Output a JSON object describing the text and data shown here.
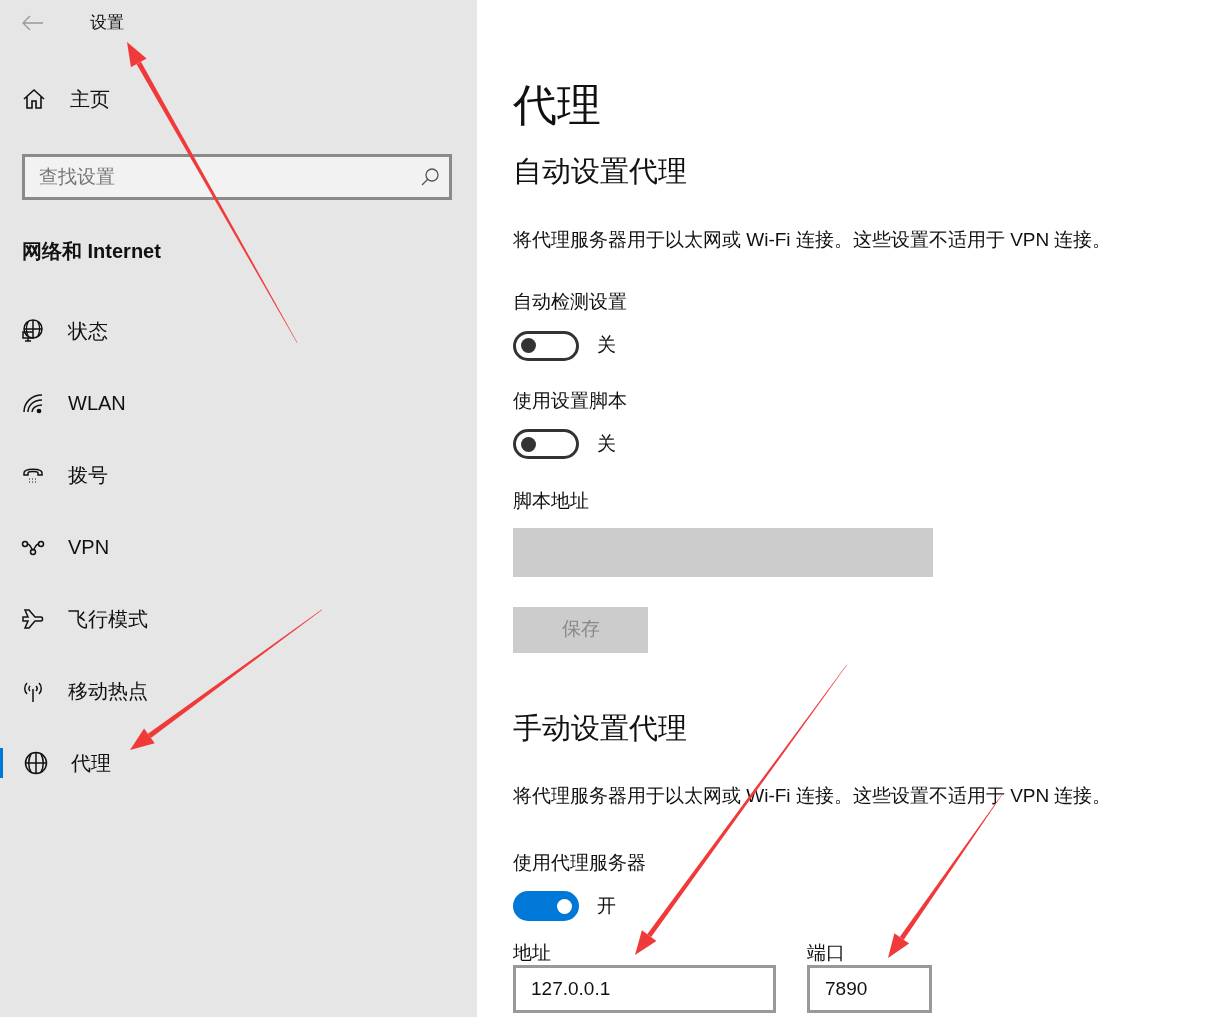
{
  "header": {
    "title": "设置"
  },
  "sidebar": {
    "home": "主页",
    "search": {
      "placeholder": "查找设置"
    },
    "section_title": "网络和 Internet",
    "items": [
      {
        "label": "状态",
        "kind": "status",
        "selected": false
      },
      {
        "label": "WLAN",
        "kind": "wlan",
        "selected": false
      },
      {
        "label": "拨号",
        "kind": "dialup",
        "selected": false
      },
      {
        "label": "VPN",
        "kind": "vpn",
        "selected": false
      },
      {
        "label": "飞行模式",
        "kind": "airplane",
        "selected": false
      },
      {
        "label": "移动热点",
        "kind": "hotspot",
        "selected": false
      },
      {
        "label": "代理",
        "kind": "proxy",
        "selected": true
      }
    ]
  },
  "main": {
    "title": "代理",
    "auto": {
      "heading": "自动设置代理",
      "description": "将代理服务器用于以太网或 Wi-Fi 连接。这些设置不适用于 VPN 连接。",
      "toggles": [
        {
          "label": "自动检测设置",
          "on": false,
          "state_text": "关"
        },
        {
          "label": "使用设置脚本",
          "on": false,
          "state_text": "关"
        }
      ],
      "script_address": {
        "label": "脚本地址",
        "disabled": true
      },
      "save_button": {
        "label": "保存",
        "disabled": true
      }
    },
    "manual": {
      "heading": "手动设置代理",
      "description": "将代理服务器用于以太网或 Wi-Fi 连接。这些设置不适用于 VPN 连接。",
      "toggle": {
        "label": "使用代理服务器",
        "on": true,
        "state_text": "开"
      },
      "address": {
        "label": "地址",
        "value": "127.0.0.1"
      },
      "port": {
        "label": "端口",
        "value": "7890"
      }
    }
  }
}
